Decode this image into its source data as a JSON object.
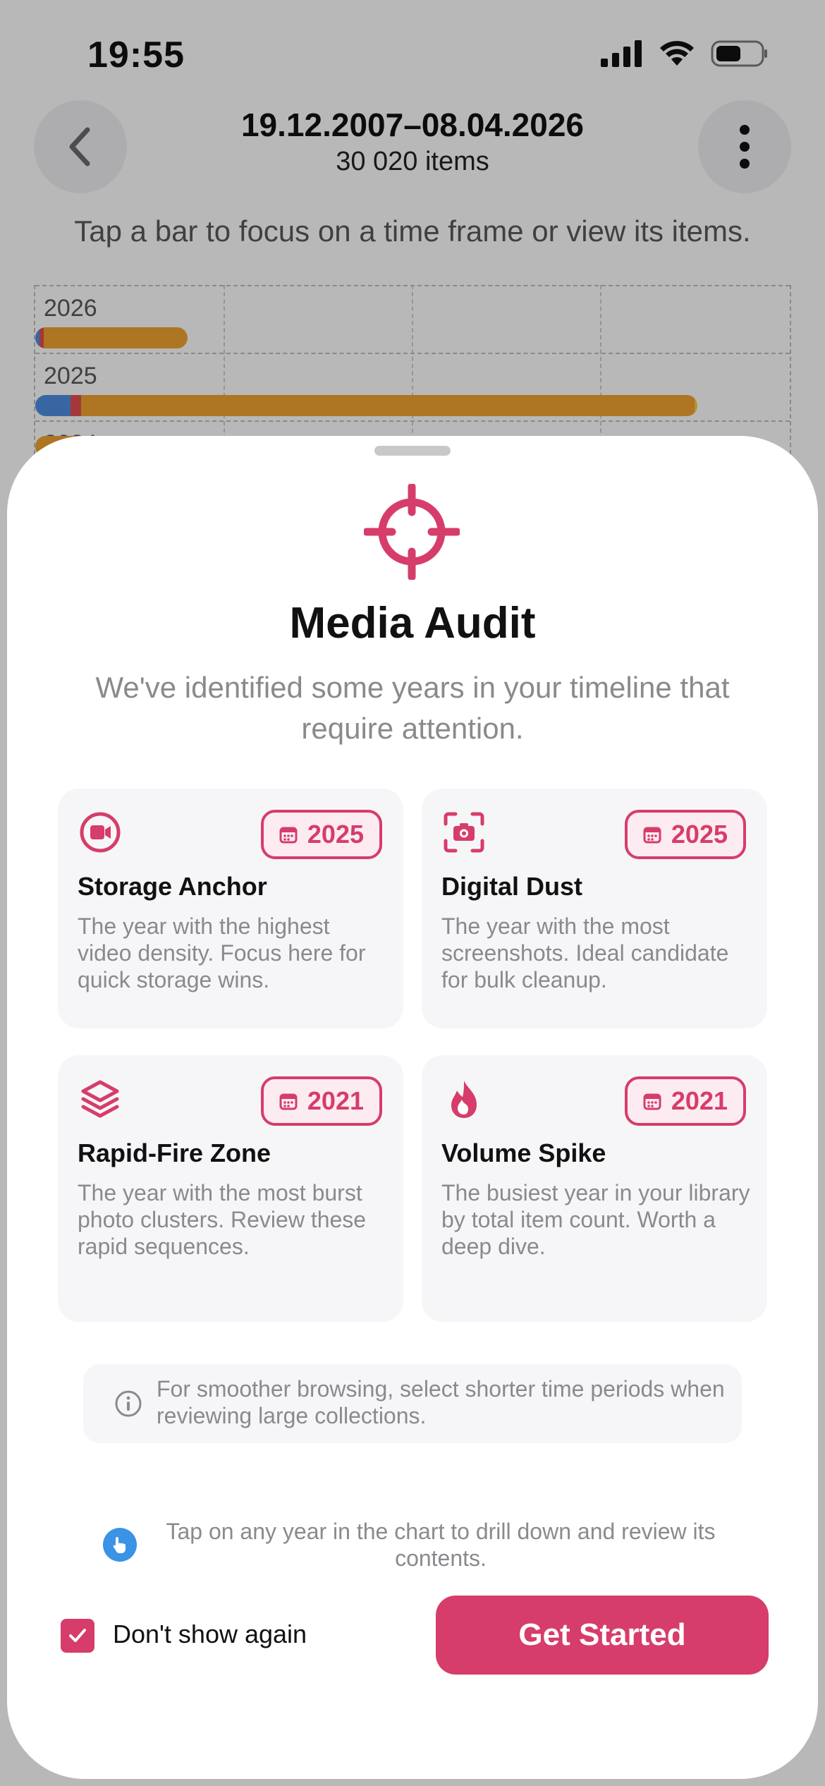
{
  "status_bar": {
    "time": "19:55"
  },
  "nav": {
    "title": "19.12.2007–08.04.2026",
    "subtitle": "30 020 items"
  },
  "hint": "Tap a bar to focus on a time frame or view its items.",
  "timeline": {
    "rows": [
      {
        "year": "2026",
        "segments": [
          {
            "color": "#4a86d6",
            "fraction": 0.006
          },
          {
            "color": "#d84a4a",
            "fraction": 0.006
          },
          {
            "color": "#e59a2d",
            "fraction": 0.19
          }
        ]
      },
      {
        "year": "2025",
        "segments": [
          {
            "color": "#4a86d6",
            "fraction": 0.047
          },
          {
            "color": "#d84a4a",
            "fraction": 0.014
          },
          {
            "color": "#e59a2d",
            "fraction": 0.81
          },
          {
            "color": "#e8c43a",
            "fraction": 0.004
          }
        ]
      },
      {
        "year": "2024",
        "segments": [
          {
            "color": "#e59a2d",
            "fraction": 0.8
          }
        ]
      }
    ]
  },
  "sheet": {
    "title": "Media Audit",
    "description": "We've identified some years in your timeline that require attention.",
    "cards": [
      {
        "icon": "video-icon",
        "year": "2025",
        "title": "Storage Anchor",
        "body": "The year with the highest video density. Focus here for quick storage wins."
      },
      {
        "icon": "screenshot-icon",
        "year": "2025",
        "title": "Digital Dust",
        "body": "The year with the most screenshots. Ideal candidate for bulk cleanup."
      },
      {
        "icon": "layers-icon",
        "year": "2021",
        "title": "Rapid-Fire Zone",
        "body": "The year with the most burst photo clusters. Review these rapid sequences."
      },
      {
        "icon": "flame-icon",
        "year": "2021",
        "title": "Volume Spike",
        "body": "The busiest year in your library by total item count. Worth a deep dive."
      }
    ],
    "info": "For smoother browsing, select shorter time periods when reviewing large collections.",
    "tip": "Tap on any year in the chart to drill down and review its contents.",
    "dont_show_label": "Don't show again",
    "dont_show_checked": true,
    "cta_label": "Get Started"
  },
  "colors": {
    "accent": "#d63d6a",
    "tip_blue": "#3a93e6"
  }
}
